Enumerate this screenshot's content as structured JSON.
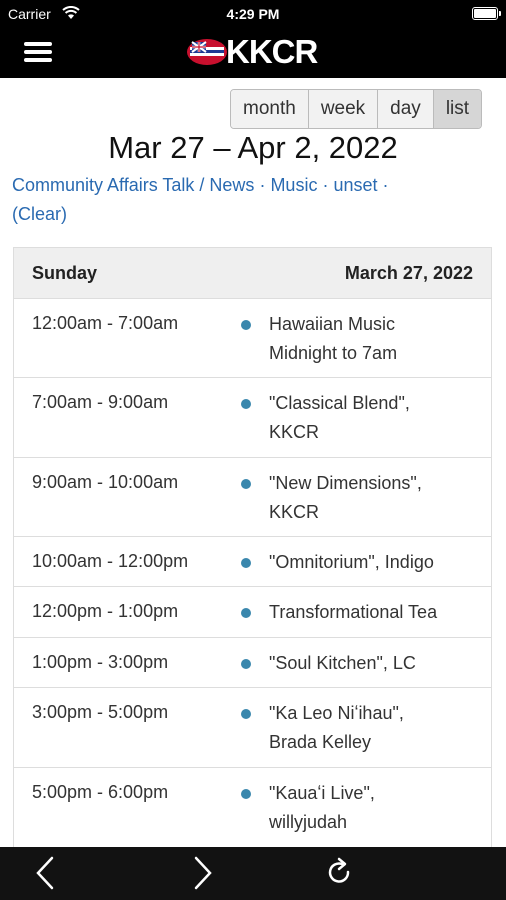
{
  "status": {
    "carrier": "Carrier",
    "time": "4:29 PM"
  },
  "app": {
    "logo_text": "KKCR"
  },
  "views": [
    "month",
    "week",
    "day",
    "list"
  ],
  "active_view": "list",
  "range_title": "Mar 27 – Apr 2, 2022",
  "filters": {
    "items": [
      "Community Affairs Talk",
      "News",
      "Music",
      "unset"
    ],
    "clear": "(Clear)"
  },
  "day": {
    "name": "Sunday",
    "date": "March 27, 2022"
  },
  "events": [
    {
      "time": "12:00am - 7:00am",
      "title_line1": "Hawaiian Music",
      "title_line2": "Midnight to 7am"
    },
    {
      "time": "7:00am - 9:00am",
      "title_line1": "\"Classical Blend\",",
      "title_line2": "KKCR"
    },
    {
      "time": "9:00am - 10:00am",
      "title_line1": "\"New Dimensions\",",
      "title_line2": "KKCR"
    },
    {
      "time": "10:00am - 12:00pm",
      "title_line1": "\"Omnitorium\", Indigo",
      "title_line2": ""
    },
    {
      "time": "12:00pm - 1:00pm",
      "title_line1": "Transformational Tea",
      "title_line2": ""
    },
    {
      "time": "1:00pm - 3:00pm",
      "title_line1": "\"Soul Kitchen\", LC",
      "title_line2": ""
    },
    {
      "time": "3:00pm - 5:00pm",
      "title_line1": "\"Ka Leo Niʻihau\",",
      "title_line2": "Brada Kelley"
    },
    {
      "time": "5:00pm - 6:00pm",
      "title_line1": "\"Kauaʻi Live\",",
      "title_line2": "willyjudah"
    }
  ],
  "colors": {
    "event_dot": "#3a87ad",
    "link": "#2a6ab1"
  },
  "icons": [
    "menu-icon",
    "wifi-icon",
    "battery-icon",
    "back-icon",
    "forward-icon",
    "refresh-icon"
  ]
}
